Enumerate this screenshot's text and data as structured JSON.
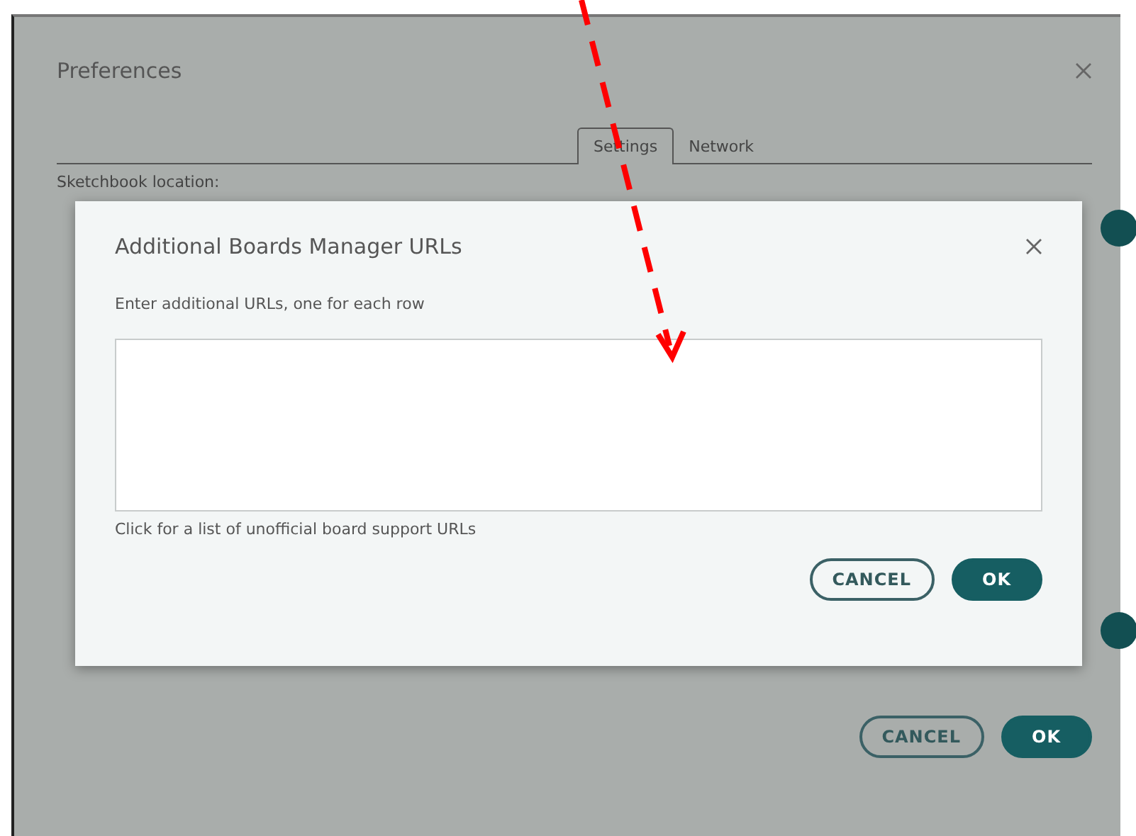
{
  "window": {
    "title": "Preferences"
  },
  "tabs": [
    {
      "label": "Settings",
      "selected": true
    },
    {
      "label": "Network",
      "selected": false
    }
  ],
  "settings": {
    "sketchbook_label": "Sketchbook location:"
  },
  "buttons": [
    {
      "label": "CANCEL",
      "kind": "secondary"
    },
    {
      "label": "OK",
      "kind": "primary"
    }
  ],
  "dialog": {
    "title": "Additional Boards Manager URLs",
    "instructions": "Enter additional URLs, one for each row",
    "link": "Click for a list of unofficial board support URLs",
    "buttons": [
      {
        "label": "CANCEL",
        "kind": "secondary"
      },
      {
        "label": "OK",
        "kind": "primary"
      }
    ]
  }
}
